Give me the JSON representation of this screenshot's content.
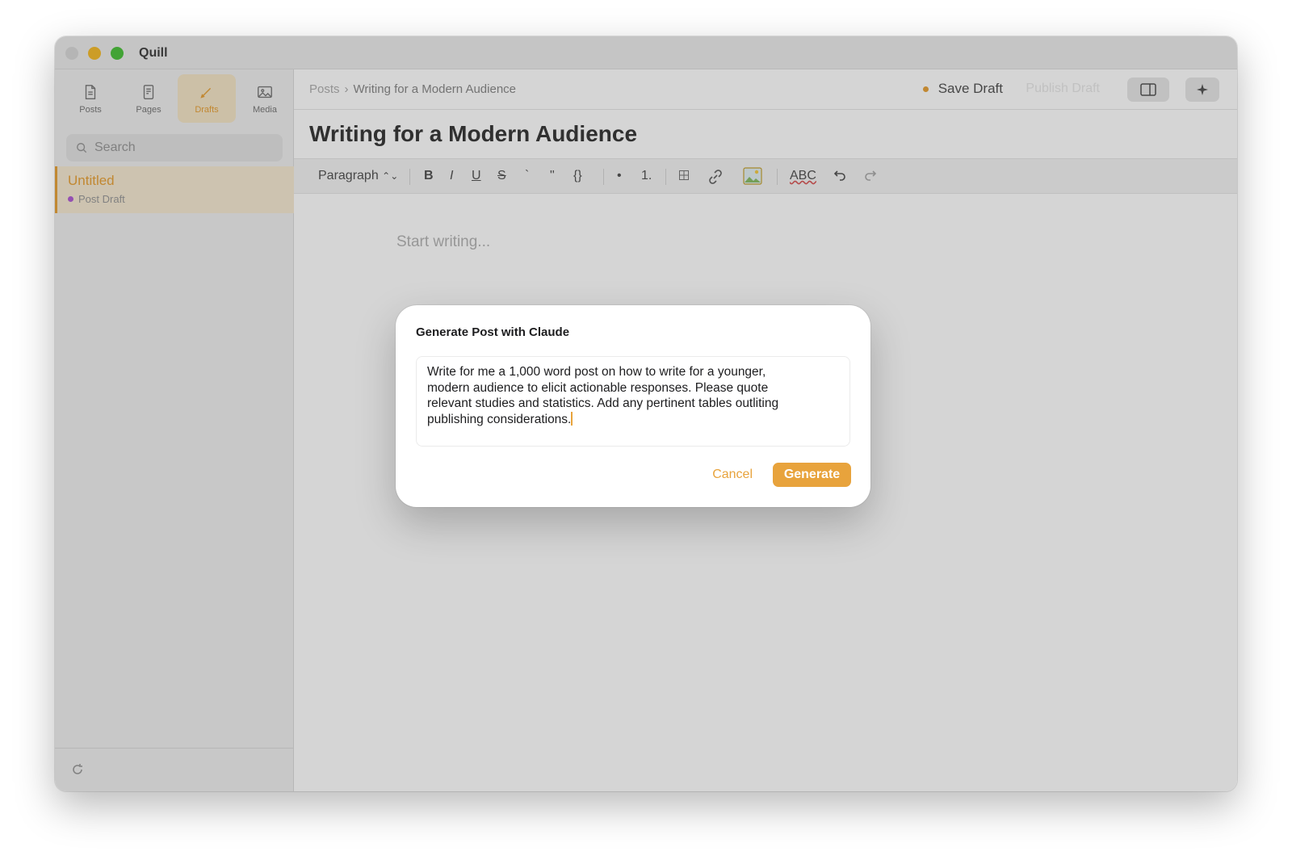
{
  "app": {
    "title": "Quill"
  },
  "sidebar": {
    "nav": [
      {
        "label": "Posts",
        "icon": "document-icon"
      },
      {
        "label": "Pages",
        "icon": "page-icon"
      },
      {
        "label": "Drafts",
        "icon": "pencil-icon",
        "active": true
      },
      {
        "label": "Media",
        "icon": "image-icon"
      }
    ],
    "search_placeholder": "Search",
    "drafts": [
      {
        "title": "Untitled",
        "status": "Post Draft"
      }
    ]
  },
  "toolbar": {
    "breadcrumb_root": "Posts",
    "breadcrumb_separator": "›",
    "breadcrumb_current": "Writing for a Modern Audience",
    "save_label": "Save Draft",
    "publish_label": "Publish Draft"
  },
  "document": {
    "title": "Writing for a Modern Audience",
    "placeholder": "Start writing..."
  },
  "format": {
    "block_style": "Paragraph",
    "bold": "B",
    "italic": "I",
    "underline": "U",
    "strike": "S",
    "code": "`",
    "quote": "\"",
    "code_block": "{}",
    "bullet": "•",
    "numbered": "1.",
    "spellcheck": "ABC"
  },
  "dialog": {
    "title": "Generate Post with Claude",
    "prompt": "Write for me a 1,000 word post on how to write for a younger,\nmodern audience to elicit actionable responses. Please quote\nrelevant studies and statistics. Add any pertinent tables outliting\npublishing considerations.",
    "cancel_label": "Cancel",
    "generate_label": "Generate"
  },
  "colors": {
    "accent": "#e8a33c",
    "draft_dot": "#b25fd6"
  }
}
